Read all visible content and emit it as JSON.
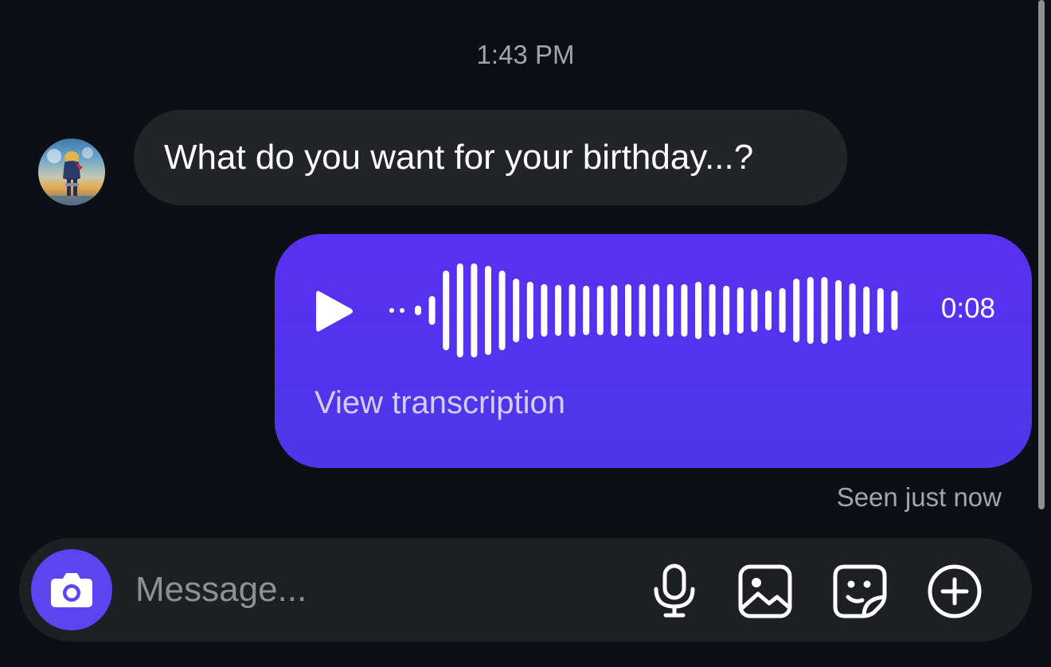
{
  "thread": {
    "timestamp": "1:43 PM",
    "incoming_message": {
      "text": "What do you want for your birthday...?",
      "avatar_icon": "contact-avatar"
    },
    "voice_message": {
      "duration": "0:08",
      "transcription_link": "View transcription",
      "play_icon": "play-icon",
      "bubble_color": "#5a36ee"
    },
    "seen_status": "Seen just now"
  },
  "composer": {
    "placeholder": "Message...",
    "value": "",
    "icons": [
      "camera-icon",
      "microphone-icon",
      "gallery-icon",
      "sticker-icon",
      "plus-circle-icon"
    ],
    "camera_button_color": "#5a45f0"
  },
  "theme": {
    "background": "#0c0f13",
    "incoming_bubble": "#222428",
    "muted_text": "#a3a5aa"
  }
}
